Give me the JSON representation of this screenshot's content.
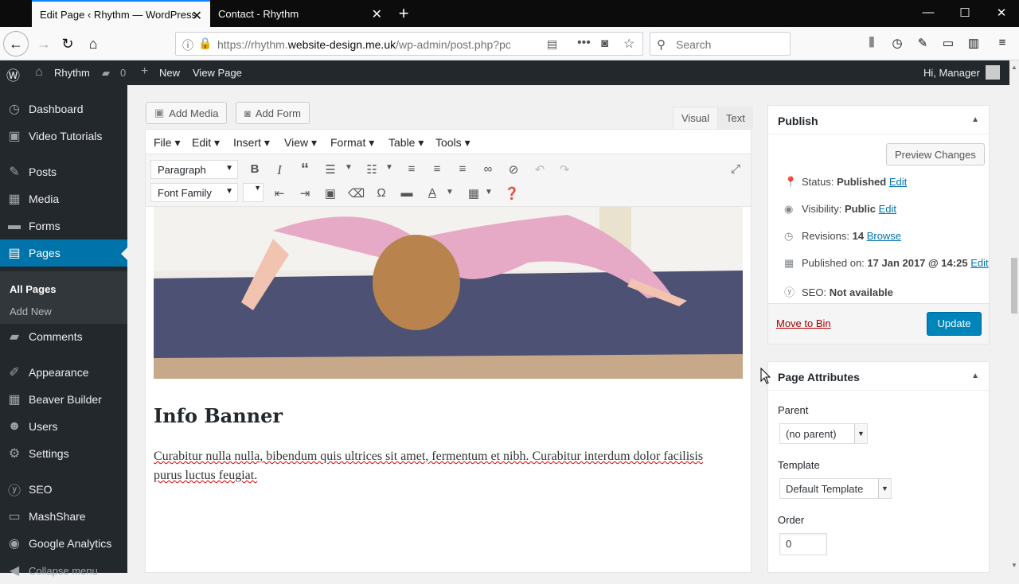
{
  "browser": {
    "tabs": [
      {
        "title": "Edit Page ‹ Rhythm — WordPress"
      },
      {
        "title": "Contact - Rhythm"
      }
    ],
    "url_prefix": "https://rhythm.",
    "url_domain": "website-design.me.uk",
    "url_suffix": "/wp-admin/post.php?po",
    "search_placeholder": "Search"
  },
  "adminbar": {
    "site_name": "Rhythm",
    "comments_count": "0",
    "new_label": "New",
    "view_page": "View Page",
    "greeting": "Hi, Manager"
  },
  "sidebar": {
    "items": [
      {
        "label": "Dashboard",
        "icon": "dashboard-icon"
      },
      {
        "label": "Video Tutorials",
        "icon": "video-icon"
      },
      {
        "label": "Posts",
        "icon": "pin-icon"
      },
      {
        "label": "Media",
        "icon": "media-icon"
      },
      {
        "label": "Forms",
        "icon": "forms-icon"
      },
      {
        "label": "Pages",
        "icon": "pages-icon"
      },
      {
        "label": "Comments",
        "icon": "comments-icon"
      },
      {
        "label": "Appearance",
        "icon": "brush-icon"
      },
      {
        "label": "Beaver Builder",
        "icon": "builder-icon"
      },
      {
        "label": "Users",
        "icon": "users-icon"
      },
      {
        "label": "Settings",
        "icon": "settings-icon"
      },
      {
        "label": "SEO",
        "icon": "seo-icon"
      },
      {
        "label": "MashShare",
        "icon": "share-icon"
      },
      {
        "label": "Google Analytics",
        "icon": "analytics-icon"
      },
      {
        "label": "Collapse menu",
        "icon": "collapse-icon"
      }
    ],
    "submenu": [
      "All Pages",
      "Add New"
    ]
  },
  "editor": {
    "add_media": "Add Media",
    "add_form": "Add Form",
    "tab_visual": "Visual",
    "tab_text": "Text",
    "menubar": [
      "File",
      "Edit",
      "Insert",
      "View",
      "Format",
      "Table",
      "Tools"
    ],
    "format_select": "Paragraph",
    "font_select": "Font Family",
    "heading": "Info Banner",
    "paragraph": "Curabitur nulla nulla, bibendum quis ultrices sit amet, fermentum et nibh. Curabitur interdum dolor facilisis purus luctus feugiat."
  },
  "publish": {
    "title": "Publish",
    "preview_button": "Preview Changes",
    "status_label": "Status:",
    "status_value": "Published",
    "visibility_label": "Visibility:",
    "visibility_value": "Public",
    "revisions_label": "Revisions:",
    "revisions_value": "14",
    "browse": "Browse",
    "published_label": "Published on:",
    "published_value": "17 Jan 2017 @ 14:25",
    "edit": "Edit",
    "seo_label": "SEO:",
    "seo_value": "Not available",
    "move_to_bin": "Move to Bin",
    "update": "Update"
  },
  "attributes": {
    "title": "Page Attributes",
    "parent_label": "Parent",
    "parent_value": "(no parent)",
    "template_label": "Template",
    "template_value": "Default Template",
    "order_label": "Order",
    "order_value": "0"
  },
  "colors": {
    "wp_blue": "#0073aa",
    "admin_dark": "#23282d",
    "danger": "#a00"
  }
}
